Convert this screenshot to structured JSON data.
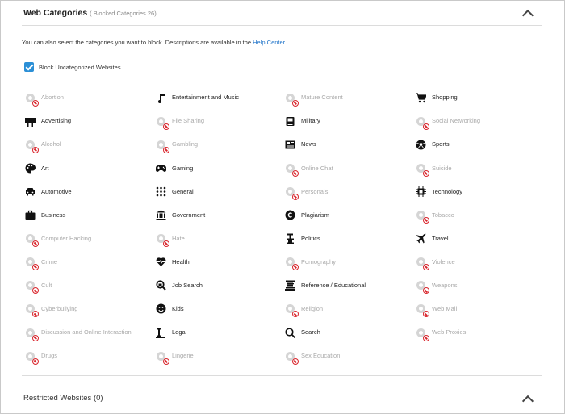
{
  "section": {
    "title": "Web Categories",
    "subtitle": "( Blocked Categories 26)"
  },
  "description": {
    "text": "You can also select the categories you want to block. Descriptions are available in the ",
    "link": "Help Center",
    "suffix": "."
  },
  "uncategorized": {
    "label": "Block Uncategorized Websites",
    "checked": true
  },
  "columns": [
    [
      {
        "label": "Abortion",
        "icon": "abortion-icon",
        "blocked": true
      },
      {
        "label": "Advertising",
        "icon": "billboard-icon",
        "blocked": false
      },
      {
        "label": "Alcohol",
        "icon": "alcohol-icon",
        "blocked": true
      },
      {
        "label": "Art",
        "icon": "palette-icon",
        "blocked": false
      },
      {
        "label": "Automotive",
        "icon": "car-icon",
        "blocked": false
      },
      {
        "label": "Business",
        "icon": "briefcase-icon",
        "blocked": false
      },
      {
        "label": "Computer Hacking",
        "icon": "hacking-icon",
        "blocked": true
      },
      {
        "label": "Crime",
        "icon": "crime-icon",
        "blocked": true
      },
      {
        "label": "Cult",
        "icon": "cult-icon",
        "blocked": true
      },
      {
        "label": "Cyberbullying",
        "icon": "cyberbullying-icon",
        "blocked": true
      },
      {
        "label": "Discussion and Online Interaction",
        "icon": "chat-bubbles-icon",
        "blocked": true
      },
      {
        "label": "Drugs",
        "icon": "pill-icon",
        "blocked": true
      }
    ],
    [
      {
        "label": "Entertainment and Music",
        "icon": "music-note-icon",
        "blocked": false
      },
      {
        "label": "File Sharing",
        "icon": "file-icon",
        "blocked": true
      },
      {
        "label": "Gambling",
        "icon": "dice-icon",
        "blocked": true
      },
      {
        "label": "Gaming",
        "icon": "gamepad-icon",
        "blocked": false
      },
      {
        "label": "General",
        "icon": "grid-dots-icon",
        "blocked": false
      },
      {
        "label": "Government",
        "icon": "bank-icon",
        "blocked": false
      },
      {
        "label": "Hate",
        "icon": "hate-icon",
        "blocked": true
      },
      {
        "label": "Health",
        "icon": "heart-pulse-icon",
        "blocked": false
      },
      {
        "label": "Job Search",
        "icon": "job-search-icon",
        "blocked": false
      },
      {
        "label": "Kids",
        "icon": "smiley-icon",
        "blocked": false
      },
      {
        "label": "Legal",
        "icon": "gavel-icon",
        "blocked": false
      },
      {
        "label": "Lingerie",
        "icon": "lingerie-icon",
        "blocked": true
      }
    ],
    [
      {
        "label": "Mature Content",
        "icon": "mature-icon",
        "blocked": true
      },
      {
        "label": "Military",
        "icon": "military-icon",
        "blocked": false
      },
      {
        "label": "News",
        "icon": "newspaper-icon",
        "blocked": false
      },
      {
        "label": "Online Chat",
        "icon": "online-chat-icon",
        "blocked": true
      },
      {
        "label": "Personals",
        "icon": "personals-icon",
        "blocked": true
      },
      {
        "label": "Plagiarism",
        "icon": "copyright-icon",
        "blocked": false
      },
      {
        "label": "Politics",
        "icon": "podium-icon",
        "blocked": false
      },
      {
        "label": "Pornography",
        "icon": "pornography-icon",
        "blocked": true
      },
      {
        "label": "Reference / Educational",
        "icon": "graduation-cap-icon",
        "blocked": false
      },
      {
        "label": "Religion",
        "icon": "religion-icon",
        "blocked": true
      },
      {
        "label": "Search",
        "icon": "search-icon",
        "blocked": false
      },
      {
        "label": "Sex Education",
        "icon": "sex-education-icon",
        "blocked": true
      }
    ],
    [
      {
        "label": "Shopping",
        "icon": "cart-icon",
        "blocked": false
      },
      {
        "label": "Social Networking",
        "icon": "social-icon",
        "blocked": true
      },
      {
        "label": "Sports",
        "icon": "soccer-ball-icon",
        "blocked": false
      },
      {
        "label": "Suicide",
        "icon": "suicide-icon",
        "blocked": true
      },
      {
        "label": "Technology",
        "icon": "chip-icon",
        "blocked": false
      },
      {
        "label": "Tobacco",
        "icon": "cigarette-icon",
        "blocked": true
      },
      {
        "label": "Travel",
        "icon": "airplane-icon",
        "blocked": false
      },
      {
        "label": "Violence",
        "icon": "violence-icon",
        "blocked": true
      },
      {
        "label": "Weapons",
        "icon": "weapons-icon",
        "blocked": true
      },
      {
        "label": "Web Mail",
        "icon": "mail-icon",
        "blocked": true
      },
      {
        "label": "Web Proxies",
        "icon": "proxy-icon",
        "blocked": true
      }
    ]
  ],
  "restricted": {
    "title": "Restricted Websites (0)"
  },
  "colors": {
    "accent": "#2b8fd6",
    "link": "#1e73c9",
    "block": "#d9252c"
  }
}
